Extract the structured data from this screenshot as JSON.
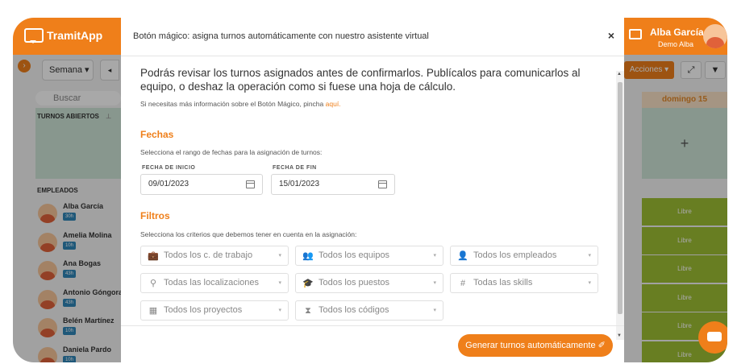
{
  "app": {
    "logo": "TramitApp",
    "user_name": "Alba García",
    "user_sub": "Demo Alba"
  },
  "sidebar": {
    "week_select": "Semana ▾",
    "prev": "◂",
    "search_placeholder": "Buscar",
    "open_shifts_label": "TURNOS ABIERTOS",
    "employees_title": "EMPLEADOS",
    "employees": [
      {
        "name": "Alba García",
        "hours": "30h"
      },
      {
        "name": "Amelia Molina",
        "hours": "10h"
      },
      {
        "name": "Ana Bogas",
        "hours": "43h"
      },
      {
        "name": "Antonio Góngora",
        "hours": "43h"
      },
      {
        "name": "Belén Martínez",
        "hours": "10h"
      },
      {
        "name": "Daniela Pardo",
        "hours": "10h"
      }
    ]
  },
  "right_panel": {
    "actions_label": "Acciones ▾",
    "expand_icon": "⤢",
    "filter_icon": "▼",
    "day_header": "domingo 15",
    "open_add": "+",
    "cells": [
      "Libre",
      "Libre",
      "Libre",
      "Libre",
      "Libre",
      "Libre"
    ]
  },
  "modal": {
    "title": "Botón mágico: asigna turnos automáticamente con nuestro asistente virtual",
    "close": "×",
    "intro": "Podrás revisar los turnos asignados antes de confirmarlos. Publícalos para comunicarlos al equipo, o deshaz la operación como si fuese una hoja de cálculo.",
    "more_info_prefix": "Si necesitas más información sobre el Botón Mágico, pincha",
    "more_info_link": "aquí.",
    "dates_title": "Fechas",
    "dates_desc": "Selecciona el rango de fechas para la asignación de turnos:",
    "start_label": "FECHA DE INICIO",
    "start_value": "09/01/2023",
    "end_label": "FECHA DE FIN",
    "end_value": "15/01/2023",
    "filters_title": "Filtros",
    "filters_desc": "Selecciona los criterios que debemos tener en cuenta en la asignación:",
    "filters": [
      {
        "label": "Todos los c. de trabajo",
        "icon": "briefcase-icon",
        "glyph": "💼"
      },
      {
        "label": "Todos los equipos",
        "icon": "team-icon",
        "glyph": "👥"
      },
      {
        "label": "Todos los empleados",
        "icon": "user-icon",
        "glyph": "👤"
      },
      {
        "label": "Todas las localizaciones",
        "icon": "location-icon",
        "glyph": "⚲"
      },
      {
        "label": "Todos los puestos",
        "icon": "graduation-cap-icon",
        "glyph": "🎓"
      },
      {
        "label": "Todas las skills",
        "icon": "hashtag-icon",
        "glyph": "#"
      },
      {
        "label": "Todos los proyectos",
        "icon": "calculator-icon",
        "glyph": "▦"
      },
      {
        "label": "Todos los códigos",
        "icon": "hourglass-icon",
        "glyph": "⧗"
      }
    ],
    "caret": "▾",
    "generate_button": "Generar turnos automáticamente ✐"
  },
  "colors": {
    "brand": "#ef7f1a",
    "libre": "#9fbf35",
    "open_shifts": "#cfe6d8",
    "hours_badge": "#2f86b8"
  }
}
